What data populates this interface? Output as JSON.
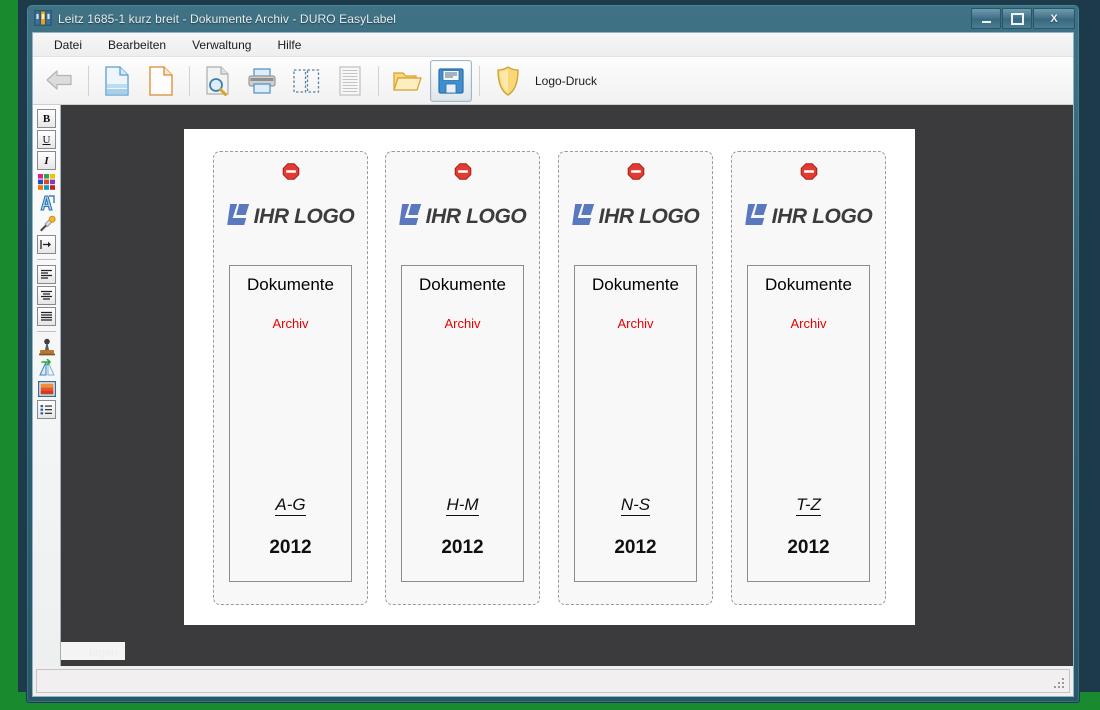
{
  "window": {
    "title": "Leitz 1685-1 kurz breit - Dokumente Archiv - DURO EasyLabel",
    "app_icon": "binders-icon",
    "controls": {
      "minimize": "minimize-button",
      "maximize": "maximize-button",
      "close_label": "X"
    }
  },
  "menubar": {
    "items": [
      {
        "label": "Datei"
      },
      {
        "label": "Bearbeiten"
      },
      {
        "label": "Verwaltung"
      },
      {
        "label": "Hilfe"
      }
    ]
  },
  "toolbar": {
    "buttons": [
      {
        "name": "back-arrow-icon",
        "title": "Zurück",
        "state": "disabled"
      },
      {
        "name": "new-document-icon",
        "title": "Neu",
        "state": "normal"
      },
      {
        "name": "blank-document-icon",
        "title": "Leeres Etikett",
        "state": "normal"
      },
      {
        "name": "print-preview-icon",
        "title": "Druckvorschau",
        "state": "normal"
      },
      {
        "name": "print-icon",
        "title": "Drucken",
        "state": "normal"
      },
      {
        "name": "page-select-icon",
        "title": "Bereich wählen",
        "state": "normal"
      },
      {
        "name": "list-lines-icon",
        "title": "Liste",
        "state": "disabled"
      },
      {
        "name": "open-folder-icon",
        "title": "Öffnen",
        "state": "normal"
      },
      {
        "name": "save-floppy-icon",
        "title": "Speichern",
        "state": "active"
      },
      {
        "name": "shield-icon",
        "title": "Logo-Druck",
        "state": "normal"
      }
    ],
    "logo_druck_label": "Logo-Druck"
  },
  "sidebar": {
    "items": [
      {
        "name": "bold-button",
        "glyph": "B",
        "kind": "chip"
      },
      {
        "name": "underline-button",
        "glyph": "U",
        "kind": "chip"
      },
      {
        "name": "italic-button",
        "glyph": "I",
        "kind": "chip"
      },
      {
        "name": "color-palette-icon",
        "kind": "palette"
      },
      {
        "name": "font-effect-icon",
        "kind": "fontfx"
      },
      {
        "name": "eyedropper-icon",
        "kind": "dropper"
      },
      {
        "name": "indent-tab-icon",
        "kind": "indent"
      },
      {
        "name": "align-left-icon",
        "kind": "align-left"
      },
      {
        "name": "align-center-icon",
        "kind": "align-center"
      },
      {
        "name": "align-justify-icon",
        "kind": "align-justify"
      },
      {
        "name": "stamp-icon",
        "kind": "stamp"
      },
      {
        "name": "flip-rotate-icon",
        "kind": "flip"
      },
      {
        "name": "image-fill-icon",
        "kind": "image"
      },
      {
        "name": "list-properties-icon",
        "kind": "listprops"
      }
    ]
  },
  "canvas": {
    "labels": [
      {
        "stop_icon": "no-entry-icon",
        "logo_mark": "ihr-logo-mark",
        "logo_text": "IHR LOGO",
        "title": "Dokumente",
        "subtitle": "Archiv",
        "range": "A-G",
        "year": "2012"
      },
      {
        "stop_icon": "no-entry-icon",
        "logo_mark": "ihr-logo-mark",
        "logo_text": "IHR LOGO",
        "title": "Dokumente",
        "subtitle": "Archiv",
        "range": "H-M",
        "year": "2012"
      },
      {
        "stop_icon": "no-entry-icon",
        "logo_mark": "ihr-logo-mark",
        "logo_text": "IHR LOGO",
        "title": "Dokumente",
        "subtitle": "Archiv",
        "range": "N-S",
        "year": "2012"
      },
      {
        "stop_icon": "no-entry-icon",
        "logo_mark": "ihr-logo-mark",
        "logo_text": "IHR LOGO",
        "title": "Dokumente",
        "subtitle": "Archiv",
        "range": "T-Z",
        "year": "2012"
      }
    ],
    "cutoff_text": "lagen"
  },
  "statusbar": {
    "text": "",
    "grip": "resize-grip"
  },
  "colors": {
    "accent_red": "#e60000",
    "logo_blue": "#5a78c0",
    "logo_gray": "#3c3c3c",
    "canvas_bg": "#3b3b3e",
    "desktop_green": "#1a8a2e",
    "frame_teal": "#2f5f72"
  }
}
